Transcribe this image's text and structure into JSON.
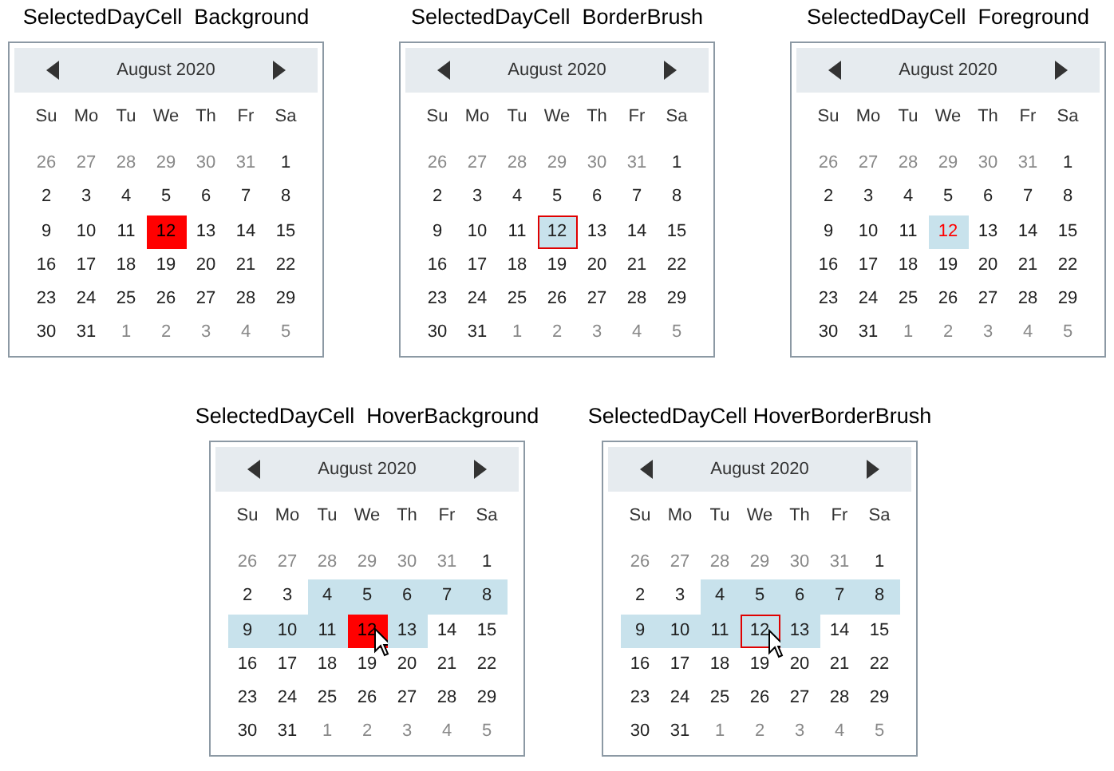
{
  "calendars": [
    {
      "caption": "SelectedDayCell  Background",
      "kind": "background",
      "cursor": false,
      "month": "August 2020",
      "weekdays": [
        "Su",
        "Mo",
        "Tu",
        "We",
        "Th",
        "Fr",
        "Sa"
      ],
      "days": [
        {
          "text": "26",
          "muted": true,
          "selected": false,
          "highlighted": false
        },
        {
          "text": "27",
          "muted": true,
          "selected": false,
          "highlighted": false
        },
        {
          "text": "28",
          "muted": true,
          "selected": false,
          "highlighted": false
        },
        {
          "text": "29",
          "muted": true,
          "selected": false,
          "highlighted": false
        },
        {
          "text": "30",
          "muted": true,
          "selected": false,
          "highlighted": false
        },
        {
          "text": "31",
          "muted": true,
          "selected": false,
          "highlighted": false
        },
        {
          "text": "1",
          "muted": false,
          "selected": false,
          "highlighted": false
        },
        {
          "text": "2",
          "muted": false,
          "selected": false,
          "highlighted": false
        },
        {
          "text": "3",
          "muted": false,
          "selected": false,
          "highlighted": false
        },
        {
          "text": "4",
          "muted": false,
          "selected": false,
          "highlighted": false
        },
        {
          "text": "5",
          "muted": false,
          "selected": false,
          "highlighted": false
        },
        {
          "text": "6",
          "muted": false,
          "selected": false,
          "highlighted": false
        },
        {
          "text": "7",
          "muted": false,
          "selected": false,
          "highlighted": false
        },
        {
          "text": "8",
          "muted": false,
          "selected": false,
          "highlighted": false
        },
        {
          "text": "9",
          "muted": false,
          "selected": false,
          "highlighted": false
        },
        {
          "text": "10",
          "muted": false,
          "selected": false,
          "highlighted": false
        },
        {
          "text": "11",
          "muted": false,
          "selected": false,
          "highlighted": false
        },
        {
          "text": "12",
          "muted": false,
          "selected": true,
          "highlighted": false
        },
        {
          "text": "13",
          "muted": false,
          "selected": false,
          "highlighted": false
        },
        {
          "text": "14",
          "muted": false,
          "selected": false,
          "highlighted": false
        },
        {
          "text": "15",
          "muted": false,
          "selected": false,
          "highlighted": false
        },
        {
          "text": "16",
          "muted": false,
          "selected": false,
          "highlighted": false
        },
        {
          "text": "17",
          "muted": false,
          "selected": false,
          "highlighted": false
        },
        {
          "text": "18",
          "muted": false,
          "selected": false,
          "highlighted": false
        },
        {
          "text": "19",
          "muted": false,
          "selected": false,
          "highlighted": false
        },
        {
          "text": "20",
          "muted": false,
          "selected": false,
          "highlighted": false
        },
        {
          "text": "21",
          "muted": false,
          "selected": false,
          "highlighted": false
        },
        {
          "text": "22",
          "muted": false,
          "selected": false,
          "highlighted": false
        },
        {
          "text": "23",
          "muted": false,
          "selected": false,
          "highlighted": false
        },
        {
          "text": "24",
          "muted": false,
          "selected": false,
          "highlighted": false
        },
        {
          "text": "25",
          "muted": false,
          "selected": false,
          "highlighted": false
        },
        {
          "text": "26",
          "muted": false,
          "selected": false,
          "highlighted": false
        },
        {
          "text": "27",
          "muted": false,
          "selected": false,
          "highlighted": false
        },
        {
          "text": "28",
          "muted": false,
          "selected": false,
          "highlighted": false
        },
        {
          "text": "29",
          "muted": false,
          "selected": false,
          "highlighted": false
        },
        {
          "text": "30",
          "muted": false,
          "selected": false,
          "highlighted": false
        },
        {
          "text": "31",
          "muted": false,
          "selected": false,
          "highlighted": false
        },
        {
          "text": "1",
          "muted": true,
          "selected": false,
          "highlighted": false
        },
        {
          "text": "2",
          "muted": true,
          "selected": false,
          "highlighted": false
        },
        {
          "text": "3",
          "muted": true,
          "selected": false,
          "highlighted": false
        },
        {
          "text": "4",
          "muted": true,
          "selected": false,
          "highlighted": false
        },
        {
          "text": "5",
          "muted": true,
          "selected": false,
          "highlighted": false
        }
      ]
    },
    {
      "caption": "SelectedDayCell  BorderBrush",
      "kind": "border",
      "cursor": false,
      "month": "August 2020",
      "weekdays": [
        "Su",
        "Mo",
        "Tu",
        "We",
        "Th",
        "Fr",
        "Sa"
      ],
      "days": [
        {
          "text": "26",
          "muted": true,
          "selected": false,
          "highlighted": false
        },
        {
          "text": "27",
          "muted": true,
          "selected": false,
          "highlighted": false
        },
        {
          "text": "28",
          "muted": true,
          "selected": false,
          "highlighted": false
        },
        {
          "text": "29",
          "muted": true,
          "selected": false,
          "highlighted": false
        },
        {
          "text": "30",
          "muted": true,
          "selected": false,
          "highlighted": false
        },
        {
          "text": "31",
          "muted": true,
          "selected": false,
          "highlighted": false
        },
        {
          "text": "1",
          "muted": false,
          "selected": false,
          "highlighted": false
        },
        {
          "text": "2",
          "muted": false,
          "selected": false,
          "highlighted": false
        },
        {
          "text": "3",
          "muted": false,
          "selected": false,
          "highlighted": false
        },
        {
          "text": "4",
          "muted": false,
          "selected": false,
          "highlighted": false
        },
        {
          "text": "5",
          "muted": false,
          "selected": false,
          "highlighted": false
        },
        {
          "text": "6",
          "muted": false,
          "selected": false,
          "highlighted": false
        },
        {
          "text": "7",
          "muted": false,
          "selected": false,
          "highlighted": false
        },
        {
          "text": "8",
          "muted": false,
          "selected": false,
          "highlighted": false
        },
        {
          "text": "9",
          "muted": false,
          "selected": false,
          "highlighted": false
        },
        {
          "text": "10",
          "muted": false,
          "selected": false,
          "highlighted": false
        },
        {
          "text": "11",
          "muted": false,
          "selected": false,
          "highlighted": false
        },
        {
          "text": "12",
          "muted": false,
          "selected": true,
          "highlighted": true
        },
        {
          "text": "13",
          "muted": false,
          "selected": false,
          "highlighted": false
        },
        {
          "text": "14",
          "muted": false,
          "selected": false,
          "highlighted": false
        },
        {
          "text": "15",
          "muted": false,
          "selected": false,
          "highlighted": false
        },
        {
          "text": "16",
          "muted": false,
          "selected": false,
          "highlighted": false
        },
        {
          "text": "17",
          "muted": false,
          "selected": false,
          "highlighted": false
        },
        {
          "text": "18",
          "muted": false,
          "selected": false,
          "highlighted": false
        },
        {
          "text": "19",
          "muted": false,
          "selected": false,
          "highlighted": false
        },
        {
          "text": "20",
          "muted": false,
          "selected": false,
          "highlighted": false
        },
        {
          "text": "21",
          "muted": false,
          "selected": false,
          "highlighted": false
        },
        {
          "text": "22",
          "muted": false,
          "selected": false,
          "highlighted": false
        },
        {
          "text": "23",
          "muted": false,
          "selected": false,
          "highlighted": false
        },
        {
          "text": "24",
          "muted": false,
          "selected": false,
          "highlighted": false
        },
        {
          "text": "25",
          "muted": false,
          "selected": false,
          "highlighted": false
        },
        {
          "text": "26",
          "muted": false,
          "selected": false,
          "highlighted": false
        },
        {
          "text": "27",
          "muted": false,
          "selected": false,
          "highlighted": false
        },
        {
          "text": "28",
          "muted": false,
          "selected": false,
          "highlighted": false
        },
        {
          "text": "29",
          "muted": false,
          "selected": false,
          "highlighted": false
        },
        {
          "text": "30",
          "muted": false,
          "selected": false,
          "highlighted": false
        },
        {
          "text": "31",
          "muted": false,
          "selected": false,
          "highlighted": false
        },
        {
          "text": "1",
          "muted": true,
          "selected": false,
          "highlighted": false
        },
        {
          "text": "2",
          "muted": true,
          "selected": false,
          "highlighted": false
        },
        {
          "text": "3",
          "muted": true,
          "selected": false,
          "highlighted": false
        },
        {
          "text": "4",
          "muted": true,
          "selected": false,
          "highlighted": false
        },
        {
          "text": "5",
          "muted": true,
          "selected": false,
          "highlighted": false
        }
      ]
    },
    {
      "caption": "SelectedDayCell  Foreground",
      "kind": "foreground",
      "cursor": false,
      "month": "August 2020",
      "weekdays": [
        "Su",
        "Mo",
        "Tu",
        "We",
        "Th",
        "Fr",
        "Sa"
      ],
      "days": [
        {
          "text": "26",
          "muted": true,
          "selected": false,
          "highlighted": false
        },
        {
          "text": "27",
          "muted": true,
          "selected": false,
          "highlighted": false
        },
        {
          "text": "28",
          "muted": true,
          "selected": false,
          "highlighted": false
        },
        {
          "text": "29",
          "muted": true,
          "selected": false,
          "highlighted": false
        },
        {
          "text": "30",
          "muted": true,
          "selected": false,
          "highlighted": false
        },
        {
          "text": "31",
          "muted": true,
          "selected": false,
          "highlighted": false
        },
        {
          "text": "1",
          "muted": false,
          "selected": false,
          "highlighted": false
        },
        {
          "text": "2",
          "muted": false,
          "selected": false,
          "highlighted": false
        },
        {
          "text": "3",
          "muted": false,
          "selected": false,
          "highlighted": false
        },
        {
          "text": "4",
          "muted": false,
          "selected": false,
          "highlighted": false
        },
        {
          "text": "5",
          "muted": false,
          "selected": false,
          "highlighted": false
        },
        {
          "text": "6",
          "muted": false,
          "selected": false,
          "highlighted": false
        },
        {
          "text": "7",
          "muted": false,
          "selected": false,
          "highlighted": false
        },
        {
          "text": "8",
          "muted": false,
          "selected": false,
          "highlighted": false
        },
        {
          "text": "9",
          "muted": false,
          "selected": false,
          "highlighted": false
        },
        {
          "text": "10",
          "muted": false,
          "selected": false,
          "highlighted": false
        },
        {
          "text": "11",
          "muted": false,
          "selected": false,
          "highlighted": false
        },
        {
          "text": "12",
          "muted": false,
          "selected": true,
          "highlighted": true
        },
        {
          "text": "13",
          "muted": false,
          "selected": false,
          "highlighted": false
        },
        {
          "text": "14",
          "muted": false,
          "selected": false,
          "highlighted": false
        },
        {
          "text": "15",
          "muted": false,
          "selected": false,
          "highlighted": false
        },
        {
          "text": "16",
          "muted": false,
          "selected": false,
          "highlighted": false
        },
        {
          "text": "17",
          "muted": false,
          "selected": false,
          "highlighted": false
        },
        {
          "text": "18",
          "muted": false,
          "selected": false,
          "highlighted": false
        },
        {
          "text": "19",
          "muted": false,
          "selected": false,
          "highlighted": false
        },
        {
          "text": "20",
          "muted": false,
          "selected": false,
          "highlighted": false
        },
        {
          "text": "21",
          "muted": false,
          "selected": false,
          "highlighted": false
        },
        {
          "text": "22",
          "muted": false,
          "selected": false,
          "highlighted": false
        },
        {
          "text": "23",
          "muted": false,
          "selected": false,
          "highlighted": false
        },
        {
          "text": "24",
          "muted": false,
          "selected": false,
          "highlighted": false
        },
        {
          "text": "25",
          "muted": false,
          "selected": false,
          "highlighted": false
        },
        {
          "text": "26",
          "muted": false,
          "selected": false,
          "highlighted": false
        },
        {
          "text": "27",
          "muted": false,
          "selected": false,
          "highlighted": false
        },
        {
          "text": "28",
          "muted": false,
          "selected": false,
          "highlighted": false
        },
        {
          "text": "29",
          "muted": false,
          "selected": false,
          "highlighted": false
        },
        {
          "text": "30",
          "muted": false,
          "selected": false,
          "highlighted": false
        },
        {
          "text": "31",
          "muted": false,
          "selected": false,
          "highlighted": false
        },
        {
          "text": "1",
          "muted": true,
          "selected": false,
          "highlighted": false
        },
        {
          "text": "2",
          "muted": true,
          "selected": false,
          "highlighted": false
        },
        {
          "text": "3",
          "muted": true,
          "selected": false,
          "highlighted": false
        },
        {
          "text": "4",
          "muted": true,
          "selected": false,
          "highlighted": false
        },
        {
          "text": "5",
          "muted": true,
          "selected": false,
          "highlighted": false
        }
      ]
    },
    {
      "caption": "SelectedDayCell  HoverBackground",
      "kind": "background",
      "cursor": true,
      "month": "August 2020",
      "weekdays": [
        "Su",
        "Mo",
        "Tu",
        "We",
        "Th",
        "Fr",
        "Sa"
      ],
      "days": [
        {
          "text": "26",
          "muted": true,
          "selected": false,
          "highlighted": false
        },
        {
          "text": "27",
          "muted": true,
          "selected": false,
          "highlighted": false
        },
        {
          "text": "28",
          "muted": true,
          "selected": false,
          "highlighted": false
        },
        {
          "text": "29",
          "muted": true,
          "selected": false,
          "highlighted": false
        },
        {
          "text": "30",
          "muted": true,
          "selected": false,
          "highlighted": false
        },
        {
          "text": "31",
          "muted": true,
          "selected": false,
          "highlighted": false
        },
        {
          "text": "1",
          "muted": false,
          "selected": false,
          "highlighted": false
        },
        {
          "text": "2",
          "muted": false,
          "selected": false,
          "highlighted": false
        },
        {
          "text": "3",
          "muted": false,
          "selected": false,
          "highlighted": false
        },
        {
          "text": "4",
          "muted": false,
          "selected": false,
          "highlighted": true
        },
        {
          "text": "5",
          "muted": false,
          "selected": false,
          "highlighted": true
        },
        {
          "text": "6",
          "muted": false,
          "selected": false,
          "highlighted": true
        },
        {
          "text": "7",
          "muted": false,
          "selected": false,
          "highlighted": true
        },
        {
          "text": "8",
          "muted": false,
          "selected": false,
          "highlighted": true
        },
        {
          "text": "9",
          "muted": false,
          "selected": false,
          "highlighted": true
        },
        {
          "text": "10",
          "muted": false,
          "selected": false,
          "highlighted": true
        },
        {
          "text": "11",
          "muted": false,
          "selected": false,
          "highlighted": true
        },
        {
          "text": "12",
          "muted": false,
          "selected": true,
          "highlighted": true
        },
        {
          "text": "13",
          "muted": false,
          "selected": false,
          "highlighted": true
        },
        {
          "text": "14",
          "muted": false,
          "selected": false,
          "highlighted": false
        },
        {
          "text": "15",
          "muted": false,
          "selected": false,
          "highlighted": false
        },
        {
          "text": "16",
          "muted": false,
          "selected": false,
          "highlighted": false
        },
        {
          "text": "17",
          "muted": false,
          "selected": false,
          "highlighted": false
        },
        {
          "text": "18",
          "muted": false,
          "selected": false,
          "highlighted": false
        },
        {
          "text": "19",
          "muted": false,
          "selected": false,
          "highlighted": false
        },
        {
          "text": "20",
          "muted": false,
          "selected": false,
          "highlighted": false
        },
        {
          "text": "21",
          "muted": false,
          "selected": false,
          "highlighted": false
        },
        {
          "text": "22",
          "muted": false,
          "selected": false,
          "highlighted": false
        },
        {
          "text": "23",
          "muted": false,
          "selected": false,
          "highlighted": false
        },
        {
          "text": "24",
          "muted": false,
          "selected": false,
          "highlighted": false
        },
        {
          "text": "25",
          "muted": false,
          "selected": false,
          "highlighted": false
        },
        {
          "text": "26",
          "muted": false,
          "selected": false,
          "highlighted": false
        },
        {
          "text": "27",
          "muted": false,
          "selected": false,
          "highlighted": false
        },
        {
          "text": "28",
          "muted": false,
          "selected": false,
          "highlighted": false
        },
        {
          "text": "29",
          "muted": false,
          "selected": false,
          "highlighted": false
        },
        {
          "text": "30",
          "muted": false,
          "selected": false,
          "highlighted": false
        },
        {
          "text": "31",
          "muted": false,
          "selected": false,
          "highlighted": false
        },
        {
          "text": "1",
          "muted": true,
          "selected": false,
          "highlighted": false
        },
        {
          "text": "2",
          "muted": true,
          "selected": false,
          "highlighted": false
        },
        {
          "text": "3",
          "muted": true,
          "selected": false,
          "highlighted": false
        },
        {
          "text": "4",
          "muted": true,
          "selected": false,
          "highlighted": false
        },
        {
          "text": "5",
          "muted": true,
          "selected": false,
          "highlighted": false
        }
      ]
    },
    {
      "caption": "SelectedDayCell HoverBorderBrush",
      "kind": "border",
      "cursor": true,
      "month": "August 2020",
      "weekdays": [
        "Su",
        "Mo",
        "Tu",
        "We",
        "Th",
        "Fr",
        "Sa"
      ],
      "days": [
        {
          "text": "26",
          "muted": true,
          "selected": false,
          "highlighted": false
        },
        {
          "text": "27",
          "muted": true,
          "selected": false,
          "highlighted": false
        },
        {
          "text": "28",
          "muted": true,
          "selected": false,
          "highlighted": false
        },
        {
          "text": "29",
          "muted": true,
          "selected": false,
          "highlighted": false
        },
        {
          "text": "30",
          "muted": true,
          "selected": false,
          "highlighted": false
        },
        {
          "text": "31",
          "muted": true,
          "selected": false,
          "highlighted": false
        },
        {
          "text": "1",
          "muted": false,
          "selected": false,
          "highlighted": false
        },
        {
          "text": "2",
          "muted": false,
          "selected": false,
          "highlighted": false
        },
        {
          "text": "3",
          "muted": false,
          "selected": false,
          "highlighted": false
        },
        {
          "text": "4",
          "muted": false,
          "selected": false,
          "highlighted": true
        },
        {
          "text": "5",
          "muted": false,
          "selected": false,
          "highlighted": true
        },
        {
          "text": "6",
          "muted": false,
          "selected": false,
          "highlighted": true
        },
        {
          "text": "7",
          "muted": false,
          "selected": false,
          "highlighted": true
        },
        {
          "text": "8",
          "muted": false,
          "selected": false,
          "highlighted": true
        },
        {
          "text": "9",
          "muted": false,
          "selected": false,
          "highlighted": true
        },
        {
          "text": "10",
          "muted": false,
          "selected": false,
          "highlighted": true
        },
        {
          "text": "11",
          "muted": false,
          "selected": false,
          "highlighted": true
        },
        {
          "text": "12",
          "muted": false,
          "selected": true,
          "highlighted": true
        },
        {
          "text": "13",
          "muted": false,
          "selected": false,
          "highlighted": true
        },
        {
          "text": "14",
          "muted": false,
          "selected": false,
          "highlighted": false
        },
        {
          "text": "15",
          "muted": false,
          "selected": false,
          "highlighted": false
        },
        {
          "text": "16",
          "muted": false,
          "selected": false,
          "highlighted": false
        },
        {
          "text": "17",
          "muted": false,
          "selected": false,
          "highlighted": false
        },
        {
          "text": "18",
          "muted": false,
          "selected": false,
          "highlighted": false
        },
        {
          "text": "19",
          "muted": false,
          "selected": false,
          "highlighted": false
        },
        {
          "text": "20",
          "muted": false,
          "selected": false,
          "highlighted": false
        },
        {
          "text": "21",
          "muted": false,
          "selected": false,
          "highlighted": false
        },
        {
          "text": "22",
          "muted": false,
          "selected": false,
          "highlighted": false
        },
        {
          "text": "23",
          "muted": false,
          "selected": false,
          "highlighted": false
        },
        {
          "text": "24",
          "muted": false,
          "selected": false,
          "highlighted": false
        },
        {
          "text": "25",
          "muted": false,
          "selected": false,
          "highlighted": false
        },
        {
          "text": "26",
          "muted": false,
          "selected": false,
          "highlighted": false
        },
        {
          "text": "27",
          "muted": false,
          "selected": false,
          "highlighted": false
        },
        {
          "text": "28",
          "muted": false,
          "selected": false,
          "highlighted": false
        },
        {
          "text": "29",
          "muted": false,
          "selected": false,
          "highlighted": false
        },
        {
          "text": "30",
          "muted": false,
          "selected": false,
          "highlighted": false
        },
        {
          "text": "31",
          "muted": false,
          "selected": false,
          "highlighted": false
        },
        {
          "text": "1",
          "muted": true,
          "selected": false,
          "highlighted": false
        },
        {
          "text": "2",
          "muted": true,
          "selected": false,
          "highlighted": false
        },
        {
          "text": "3",
          "muted": true,
          "selected": false,
          "highlighted": false
        },
        {
          "text": "4",
          "muted": true,
          "selected": false,
          "highlighted": false
        },
        {
          "text": "5",
          "muted": true,
          "selected": false,
          "highlighted": false
        }
      ]
    }
  ]
}
